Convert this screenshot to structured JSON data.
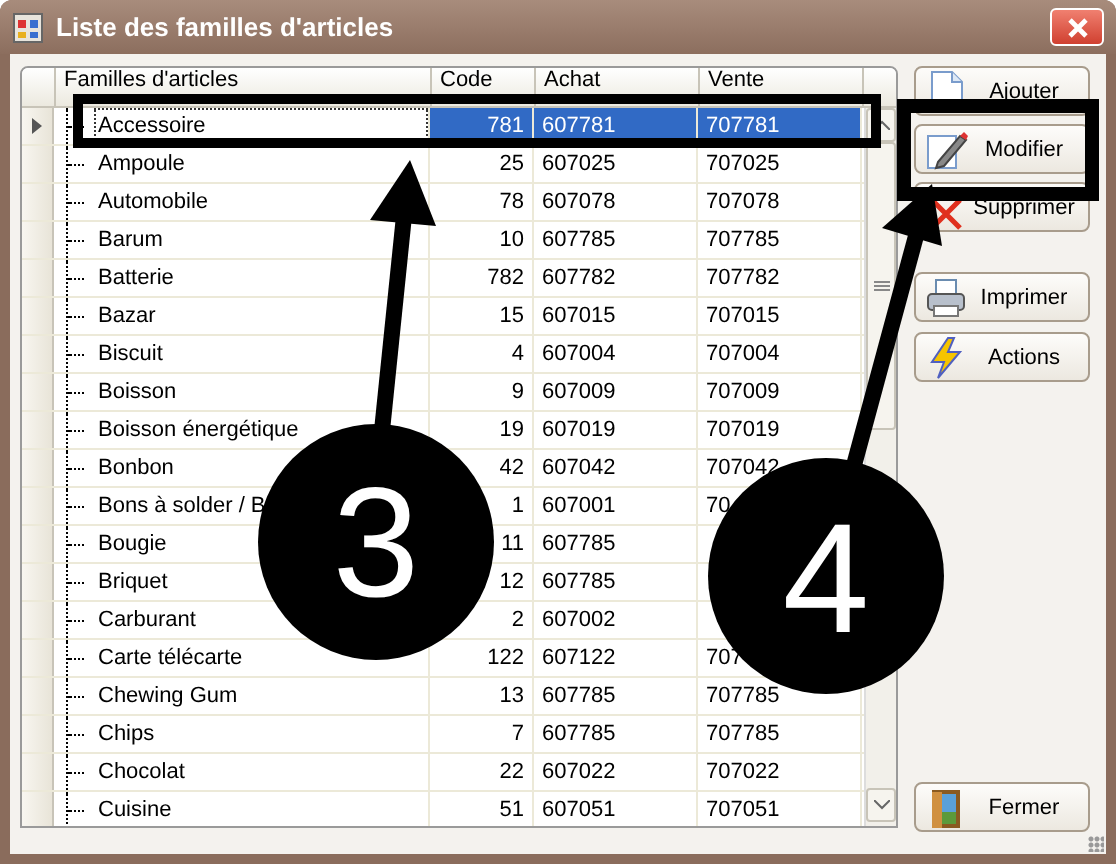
{
  "window": {
    "title": "Liste des familles d'articles"
  },
  "table": {
    "columns": [
      "Familles d'articles",
      "Code",
      "Achat",
      "Vente"
    ],
    "rows": [
      {
        "name": "Accessoire",
        "code": "781",
        "achat": "607781",
        "vente": "707781",
        "selected": true
      },
      {
        "name": "Ampoule",
        "code": "25",
        "achat": "607025",
        "vente": "707025",
        "selected": false
      },
      {
        "name": "Automobile",
        "code": "78",
        "achat": "607078",
        "vente": "707078",
        "selected": false
      },
      {
        "name": "Barum",
        "code": "10",
        "achat": "607785",
        "vente": "707785",
        "selected": false
      },
      {
        "name": "Batterie",
        "code": "782",
        "achat": "607782",
        "vente": "707782",
        "selected": false
      },
      {
        "name": "Bazar",
        "code": "15",
        "achat": "607015",
        "vente": "707015",
        "selected": false
      },
      {
        "name": "Biscuit",
        "code": "4",
        "achat": "607004",
        "vente": "707004",
        "selected": false
      },
      {
        "name": "Boisson",
        "code": "9",
        "achat": "607009",
        "vente": "707009",
        "selected": false
      },
      {
        "name": "Boisson énergétique",
        "code": "19",
        "achat": "607019",
        "vente": "707019",
        "selected": false
      },
      {
        "name": "Bonbon",
        "code": "42",
        "achat": "607042",
        "vente": "707042",
        "selected": false
      },
      {
        "name": "Bons à solder / B",
        "code": "1",
        "achat": "607001",
        "vente": "70",
        "selected": false
      },
      {
        "name": "Bougie",
        "code": "11",
        "achat": "607785",
        "selected": false
      },
      {
        "name": "Briquet",
        "code": "12",
        "achat": "607785",
        "selected": false
      },
      {
        "name": "Carburant",
        "code": "2",
        "achat": "607002",
        "selected": false
      },
      {
        "name": "Carte télécarte",
        "code": "122",
        "achat": "607122",
        "vente": "707",
        "selected": false
      },
      {
        "name": "Chewing Gum",
        "code": "13",
        "achat": "607785",
        "vente": "707785",
        "selected": false
      },
      {
        "name": "Chips",
        "code": "7",
        "achat": "607785",
        "vente": "707785",
        "selected": false
      },
      {
        "name": "Chocolat",
        "code": "22",
        "achat": "607022",
        "vente": "707022",
        "selected": false
      },
      {
        "name": "Cuisine",
        "code": "51",
        "achat": "607051",
        "vente": "707051",
        "selected": false
      }
    ]
  },
  "buttons": [
    {
      "label": "Ajouter",
      "kind": "add"
    },
    {
      "label": "Modifier",
      "kind": "edit"
    },
    {
      "label": "Supprimer",
      "kind": "delete"
    },
    {
      "label": "Imprimer",
      "kind": "print"
    },
    {
      "label": "Actions",
      "kind": "actions"
    },
    {
      "label": "Fermer",
      "kind": "close"
    }
  ],
  "annotations": [
    {
      "number": "3"
    },
    {
      "number": "4"
    }
  ]
}
